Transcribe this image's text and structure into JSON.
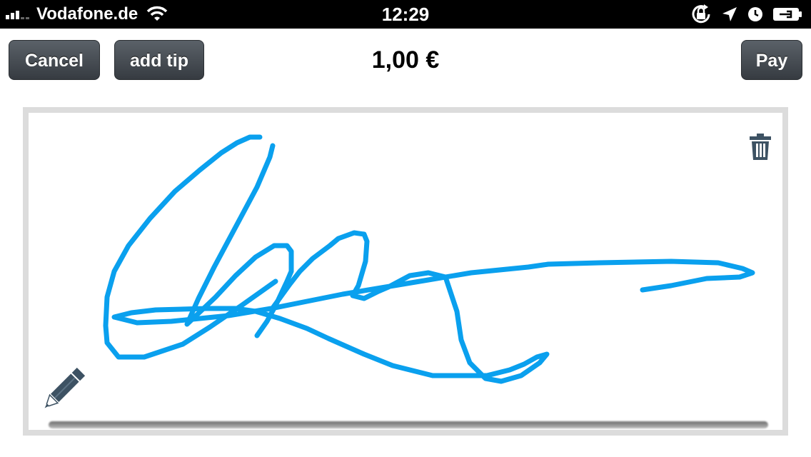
{
  "status_bar": {
    "carrier": "Vodafone.de",
    "time": "12:29",
    "icons": [
      "signal-icon",
      "wifi-icon",
      "rotation-lock-icon",
      "location-icon",
      "alarm-icon",
      "battery-charging-icon"
    ]
  },
  "toolbar": {
    "cancel_label": "Cancel",
    "add_tip_label": "add tip",
    "amount": "1,00 €",
    "pay_label": "Pay"
  },
  "signature_pad": {
    "icons": [
      "trash-icon",
      "pencil-icon"
    ],
    "stroke_color": "#0aa0ee"
  },
  "colors": {
    "button_bg": "#474d53",
    "frame": "#dcdcdc",
    "icon_color": "#3d5263"
  }
}
